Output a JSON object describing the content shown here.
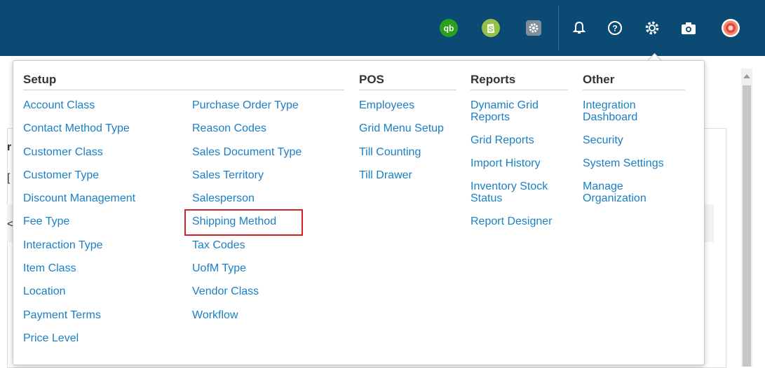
{
  "topbar": {
    "icons": [
      {
        "name": "quickbooks-icon",
        "color": "#2ca01c",
        "glyph": "qb"
      },
      {
        "name": "shopify-icon",
        "color": "#95bf47",
        "glyph": "S"
      },
      {
        "name": "integration-gear-icon",
        "color": "#8a9aa6",
        "glyph": "⚙"
      },
      {
        "name": "bell-icon",
        "glyph": "🔔"
      },
      {
        "name": "help-icon",
        "glyph": "?"
      },
      {
        "name": "settings-gear-icon",
        "glyph": "⚙"
      },
      {
        "name": "camera-icon",
        "glyph": "📷"
      },
      {
        "name": "user-avatar-icon",
        "color": "#e8453c"
      }
    ]
  },
  "background": {
    "fragments": [
      "r",
      "[",
      "<"
    ]
  },
  "menu": {
    "setup": {
      "header": "Setup",
      "col1": [
        "Account Class",
        "Contact Method Type",
        "Customer Class",
        "Customer Type",
        "Discount Management",
        "Fee Type",
        "Interaction Type",
        "Item Class",
        "Location",
        "Payment Terms",
        "Price Level"
      ],
      "col2": [
        "Purchase Order Type",
        "Reason Codes",
        "Sales Document Type",
        "Sales Territory",
        "Salesperson",
        "Shipping Method",
        "Tax Codes",
        "UofM Type",
        "Vendor Class",
        "Workflow"
      ]
    },
    "pos": {
      "header": "POS",
      "items": [
        "Employees",
        "Grid Menu Setup",
        "Till Counting",
        "Till Drawer"
      ]
    },
    "reports": {
      "header": "Reports",
      "items": [
        "Dynamic Grid Reports",
        "Grid Reports",
        "Import History",
        "Inventory Stock Status",
        "Report Designer"
      ]
    },
    "other": {
      "header": "Other",
      "items": [
        "Integration Dashboard",
        "Security",
        "System Settings",
        "Manage Organization"
      ]
    }
  }
}
